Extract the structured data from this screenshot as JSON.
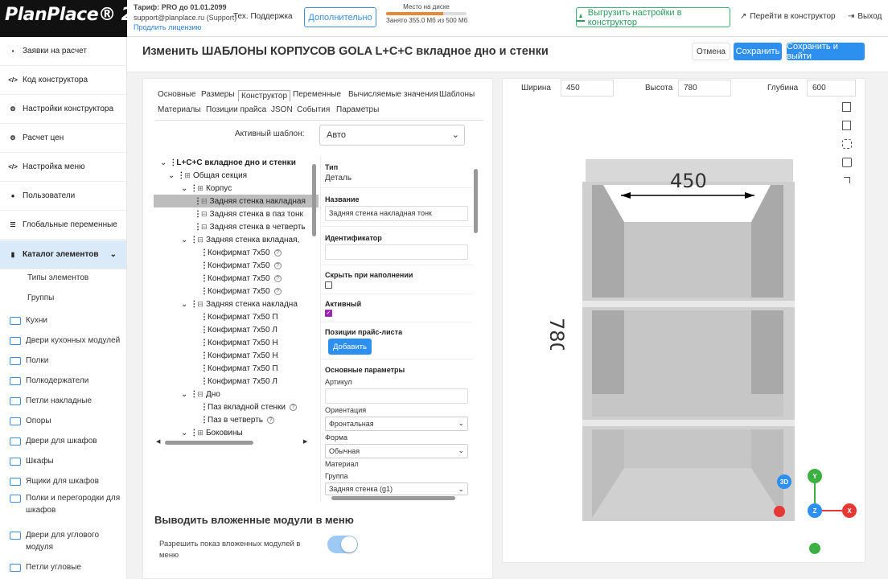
{
  "app": {
    "logo_text": "PlanPlace® 2.0"
  },
  "topbar": {
    "tariff_prefix": "Тариф:",
    "tariff": "PRO до 01.01.2099",
    "support_email": "support@planplace.ru (Support)",
    "extend_license": "Продлить лицензию",
    "tech_support": "Тех. Поддержка",
    "more_button": "Дополнительно",
    "disk_title": "Место на диске",
    "disk_usage": "Занято 355.0 Мб из 500 Мб",
    "disk_fraction": 0.71,
    "export_button": "Выгрузить настройки в конструктор",
    "goto_constructor": "Перейти в конструктор",
    "logout": "Выход"
  },
  "sidebar": {
    "items": [
      {
        "label": "Заявки на расчет",
        "icon": "document-icon"
      },
      {
        "label": "Код конструктора",
        "icon": "code-icon"
      },
      {
        "label": "Настройки конструктора",
        "icon": "gears-icon"
      },
      {
        "label": "Расчет цен",
        "icon": "gears-icon"
      },
      {
        "label": "Настройка меню",
        "icon": "code-icon"
      },
      {
        "label": "Пользователи",
        "icon": "user-icon"
      },
      {
        "label": "Глобальные переменные",
        "icon": "list-icon"
      },
      {
        "label": "Каталог элементов",
        "icon": "book-icon"
      }
    ],
    "subitems": [
      "Типы элементов",
      "Группы"
    ],
    "categories": [
      "Кухни",
      "Двери кухонных модулей",
      "Полки",
      "Полкодержатели",
      "Петли накладные",
      "Опоры",
      "Двери для шкафов",
      "Шкафы",
      "Ящики для шкафов",
      "Полки и перегородки для шкафов",
      "Двери для углового модуля",
      "Петли угловые"
    ]
  },
  "header": {
    "title": "Изменить ШАБЛОНЫ КОРПУСОВ GOLA L+C+C вкладное дно и стенки",
    "cancel": "Отмена",
    "save": "Сохранить",
    "save_exit": "Сохранить и выйти"
  },
  "tabs": {
    "row1": [
      "Основные",
      "Размеры",
      "Конструктор",
      "Переменные",
      "Вычисляемые значения",
      "Шаблоны"
    ],
    "row2": [
      "Материалы",
      "Позиции прайса",
      "JSON",
      "События",
      "Параметры"
    ],
    "active": "Конструктор"
  },
  "template": {
    "label": "Активный шаблон:",
    "value": "Авто"
  },
  "tree": [
    {
      "label": "L+C+C вкладное дно и стенки",
      "level": 0,
      "bold": true,
      "toggle": "⌄",
      "box": ""
    },
    {
      "label": "Общая секция",
      "level": 1,
      "toggle": "⌄",
      "box": "⊞"
    },
    {
      "label": "Корпус",
      "level": 2,
      "toggle": "⌄",
      "box": "⊞"
    },
    {
      "label": "Задняя стенка накладная",
      "level": 3,
      "toggle": "",
      "box": "⊟",
      "selected": true
    },
    {
      "label": "Задняя стенка в паз тонк",
      "level": 3,
      "toggle": "",
      "box": "⊟"
    },
    {
      "label": "Задняя стенка в четверть",
      "level": 3,
      "toggle": "",
      "box": "⊟"
    },
    {
      "label": "Задняя стенка вкладная,",
      "level": 2,
      "toggle": "⌄",
      "box": "⊟"
    },
    {
      "label": "Конфирмат 7х50",
      "level": 4,
      "toggle": "",
      "box": "",
      "help": true
    },
    {
      "label": "Конфирмат 7х50",
      "level": 4,
      "toggle": "",
      "box": "",
      "help": true
    },
    {
      "label": "Конфирмат 7х50",
      "level": 4,
      "toggle": "",
      "box": "",
      "help": true
    },
    {
      "label": "Конфирмат 7х50",
      "level": 4,
      "toggle": "",
      "box": "",
      "help": true
    },
    {
      "label": "Задняя стенка накладна",
      "level": 2,
      "toggle": "⌄",
      "box": "⊟"
    },
    {
      "label": "Конфирмат 7х50 П",
      "level": 4,
      "toggle": "",
      "box": ""
    },
    {
      "label": "Конфирмат 7х50 Л",
      "level": 4,
      "toggle": "",
      "box": ""
    },
    {
      "label": "Конфирмат 7х50 Н",
      "level": 4,
      "toggle": "",
      "box": ""
    },
    {
      "label": "Конфирмат 7х50 Н",
      "level": 4,
      "toggle": "",
      "box": ""
    },
    {
      "label": "Конфирмат 7х50 П",
      "level": 4,
      "toggle": "",
      "box": ""
    },
    {
      "label": "Конфирмат 7х50 Л",
      "level": 4,
      "toggle": "",
      "box": ""
    },
    {
      "label": "Дно",
      "level": 2,
      "toggle": "⌄",
      "box": "⊟"
    },
    {
      "label": "Паз вкладной стенки",
      "level": 4,
      "toggle": "",
      "box": "",
      "help": true
    },
    {
      "label": "Паз в четверть",
      "level": 4,
      "toggle": "",
      "box": "",
      "help": true
    },
    {
      "label": "Боковины",
      "level": 2,
      "toggle": "⌄",
      "box": "⊞"
    }
  ],
  "props": {
    "type_label": "Тип",
    "type_value": "Деталь",
    "name_label": "Название",
    "name_value": "Задняя стенка накладная тонк",
    "id_label": "Идентификатор",
    "id_value": "",
    "hide_label": "Скрыть при наполнении",
    "hide_checked": false,
    "active_label": "Активный",
    "active_checked": true,
    "price_label": "Позиции прайс-листа",
    "add_button": "Добавить",
    "basic_label": "Основные параметры",
    "article_label": "Артикул",
    "article_value": "",
    "orientation_label": "Ориентация",
    "orientation_value": "Фронтальная",
    "shape_label": "Форма",
    "shape_value": "Обычная",
    "material_label": "Материал",
    "group_label": "Группа",
    "group_value": "Задняя стенка (g1)"
  },
  "nested": {
    "title": "Выводить вложенные модули в меню",
    "allow_label": "Разрешить показ вложенных модулей в меню",
    "allow_on": true
  },
  "view": {
    "width_label": "Ширина",
    "width_value": "450",
    "height_label": "Высота",
    "height_value": "780",
    "depth_label": "Глубина",
    "depth_value": "600",
    "dim_width": "450",
    "dim_height": "780",
    "btn_3d": "3D",
    "axis_y": "Y",
    "axis_z": "Z",
    "axis_x": "X",
    "colors": {
      "y": "#3cb043",
      "z": "#2d8ff0",
      "x": "#e53935",
      "red_dot": "#e53935",
      "green_dot": "#3cb043"
    }
  },
  "colors": {
    "accent": "#2d8ff0",
    "sidebar_active": "#dbeaf8",
    "toggle_on": "#9ec9f5"
  }
}
